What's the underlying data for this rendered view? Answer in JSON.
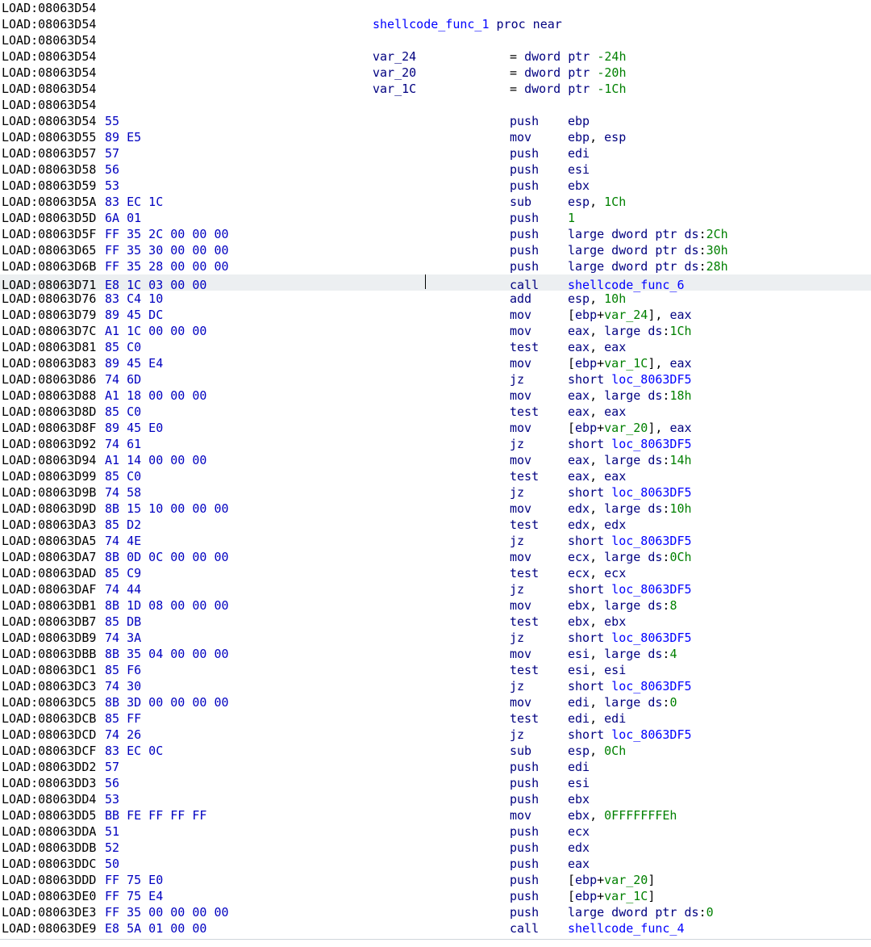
{
  "segment": "LOAD",
  "func_header": {
    "name": "shellcode_func_1",
    "kind": "proc near",
    "vars": [
      {
        "name": "var_24",
        "def": "= dword ptr -24h"
      },
      {
        "name": "var_20",
        "def": "= dword ptr -20h"
      },
      {
        "name": "var_1C",
        "def": "= dword ptr -1Ch"
      }
    ]
  },
  "rows": [
    {
      "addr": "08063D54",
      "kind": "blank"
    },
    {
      "addr": "08063D54",
      "kind": "func_name"
    },
    {
      "addr": "08063D54",
      "kind": "blank"
    },
    {
      "addr": "08063D54",
      "kind": "var",
      "var_index": 0
    },
    {
      "addr": "08063D54",
      "kind": "var",
      "var_index": 1
    },
    {
      "addr": "08063D54",
      "kind": "var",
      "var_index": 2
    },
    {
      "addr": "08063D54",
      "kind": "blank"
    },
    {
      "addr": "08063D54",
      "bytes": "55",
      "mn": "push",
      "ops": [
        {
          "t": "reg",
          "v": "ebp"
        }
      ]
    },
    {
      "addr": "08063D55",
      "bytes": "89 E5",
      "mn": "mov",
      "ops": [
        {
          "t": "reg",
          "v": "ebp"
        },
        {
          "t": "punc",
          "v": ", "
        },
        {
          "t": "reg",
          "v": "esp"
        }
      ]
    },
    {
      "addr": "08063D57",
      "bytes": "57",
      "mn": "push",
      "ops": [
        {
          "t": "reg",
          "v": "edi"
        }
      ]
    },
    {
      "addr": "08063D58",
      "bytes": "56",
      "mn": "push",
      "ops": [
        {
          "t": "reg",
          "v": "esi"
        }
      ]
    },
    {
      "addr": "08063D59",
      "bytes": "53",
      "mn": "push",
      "ops": [
        {
          "t": "reg",
          "v": "ebx"
        }
      ]
    },
    {
      "addr": "08063D5A",
      "bytes": "83 EC 1C",
      "mn": "sub",
      "ops": [
        {
          "t": "reg",
          "v": "esp"
        },
        {
          "t": "punc",
          "v": ", "
        },
        {
          "t": "num",
          "v": "1Ch"
        }
      ]
    },
    {
      "addr": "08063D5D",
      "bytes": "6A 01",
      "mn": "push",
      "ops": [
        {
          "t": "num",
          "v": "1"
        }
      ]
    },
    {
      "addr": "08063D5F",
      "bytes": "FF 35 2C 00 00 00",
      "mn": "push",
      "ops": [
        {
          "t": "kw",
          "v": "large dword ptr "
        },
        {
          "t": "reg",
          "v": "ds"
        },
        {
          "t": "punc",
          "v": ":"
        },
        {
          "t": "num",
          "v": "2Ch"
        }
      ]
    },
    {
      "addr": "08063D65",
      "bytes": "FF 35 30 00 00 00",
      "mn": "push",
      "ops": [
        {
          "t": "kw",
          "v": "large dword ptr "
        },
        {
          "t": "reg",
          "v": "ds"
        },
        {
          "t": "punc",
          "v": ":"
        },
        {
          "t": "num",
          "v": "30h"
        }
      ]
    },
    {
      "addr": "08063D6B",
      "bytes": "FF 35 28 00 00 00",
      "mn": "push",
      "ops": [
        {
          "t": "kw",
          "v": "large dword ptr "
        },
        {
          "t": "reg",
          "v": "ds"
        },
        {
          "t": "punc",
          "v": ":"
        },
        {
          "t": "num",
          "v": "28h"
        }
      ]
    },
    {
      "addr": "08063D71",
      "bytes": "E8 1C 03 00 00",
      "mn": "call",
      "ops": [
        {
          "t": "func",
          "v": "shellcode_func_6"
        }
      ],
      "highlight": true,
      "cursor": true
    },
    {
      "addr": "08063D76",
      "bytes": "83 C4 10",
      "mn": "add",
      "ops": [
        {
          "t": "reg",
          "v": "esp"
        },
        {
          "t": "punc",
          "v": ", "
        },
        {
          "t": "num",
          "v": "10h"
        }
      ]
    },
    {
      "addr": "08063D79",
      "bytes": "89 45 DC",
      "mn": "mov",
      "ops": [
        {
          "t": "punc",
          "v": "["
        },
        {
          "t": "reg",
          "v": "ebp"
        },
        {
          "t": "punc",
          "v": "+"
        },
        {
          "t": "var",
          "v": "var_24"
        },
        {
          "t": "punc",
          "v": "], "
        },
        {
          "t": "reg",
          "v": "eax"
        }
      ]
    },
    {
      "addr": "08063D7C",
      "bytes": "A1 1C 00 00 00",
      "mn": "mov",
      "ops": [
        {
          "t": "reg",
          "v": "eax"
        },
        {
          "t": "punc",
          "v": ", "
        },
        {
          "t": "kw",
          "v": "large "
        },
        {
          "t": "reg",
          "v": "ds"
        },
        {
          "t": "punc",
          "v": ":"
        },
        {
          "t": "num",
          "v": "1Ch"
        }
      ]
    },
    {
      "addr": "08063D81",
      "bytes": "85 C0",
      "mn": "test",
      "ops": [
        {
          "t": "reg",
          "v": "eax"
        },
        {
          "t": "punc",
          "v": ", "
        },
        {
          "t": "reg",
          "v": "eax"
        }
      ]
    },
    {
      "addr": "08063D83",
      "bytes": "89 45 E4",
      "mn": "mov",
      "ops": [
        {
          "t": "punc",
          "v": "["
        },
        {
          "t": "reg",
          "v": "ebp"
        },
        {
          "t": "punc",
          "v": "+"
        },
        {
          "t": "var",
          "v": "var_1C"
        },
        {
          "t": "punc",
          "v": "], "
        },
        {
          "t": "reg",
          "v": "eax"
        }
      ]
    },
    {
      "addr": "08063D86",
      "bytes": "74 6D",
      "mn": "jz",
      "ops": [
        {
          "t": "kw",
          "v": "short "
        },
        {
          "t": "func",
          "v": "loc_8063DF5"
        }
      ]
    },
    {
      "addr": "08063D88",
      "bytes": "A1 18 00 00 00",
      "mn": "mov",
      "ops": [
        {
          "t": "reg",
          "v": "eax"
        },
        {
          "t": "punc",
          "v": ", "
        },
        {
          "t": "kw",
          "v": "large "
        },
        {
          "t": "reg",
          "v": "ds"
        },
        {
          "t": "punc",
          "v": ":"
        },
        {
          "t": "num",
          "v": "18h"
        }
      ]
    },
    {
      "addr": "08063D8D",
      "bytes": "85 C0",
      "mn": "test",
      "ops": [
        {
          "t": "reg",
          "v": "eax"
        },
        {
          "t": "punc",
          "v": ", "
        },
        {
          "t": "reg",
          "v": "eax"
        }
      ]
    },
    {
      "addr": "08063D8F",
      "bytes": "89 45 E0",
      "mn": "mov",
      "ops": [
        {
          "t": "punc",
          "v": "["
        },
        {
          "t": "reg",
          "v": "ebp"
        },
        {
          "t": "punc",
          "v": "+"
        },
        {
          "t": "var",
          "v": "var_20"
        },
        {
          "t": "punc",
          "v": "], "
        },
        {
          "t": "reg",
          "v": "eax"
        }
      ]
    },
    {
      "addr": "08063D92",
      "bytes": "74 61",
      "mn": "jz",
      "ops": [
        {
          "t": "kw",
          "v": "short "
        },
        {
          "t": "func",
          "v": "loc_8063DF5"
        }
      ]
    },
    {
      "addr": "08063D94",
      "bytes": "A1 14 00 00 00",
      "mn": "mov",
      "ops": [
        {
          "t": "reg",
          "v": "eax"
        },
        {
          "t": "punc",
          "v": ", "
        },
        {
          "t": "kw",
          "v": "large "
        },
        {
          "t": "reg",
          "v": "ds"
        },
        {
          "t": "punc",
          "v": ":"
        },
        {
          "t": "num",
          "v": "14h"
        }
      ]
    },
    {
      "addr": "08063D99",
      "bytes": "85 C0",
      "mn": "test",
      "ops": [
        {
          "t": "reg",
          "v": "eax"
        },
        {
          "t": "punc",
          "v": ", "
        },
        {
          "t": "reg",
          "v": "eax"
        }
      ]
    },
    {
      "addr": "08063D9B",
      "bytes": "74 58",
      "mn": "jz",
      "ops": [
        {
          "t": "kw",
          "v": "short "
        },
        {
          "t": "func",
          "v": "loc_8063DF5"
        }
      ]
    },
    {
      "addr": "08063D9D",
      "bytes": "8B 15 10 00 00 00",
      "mn": "mov",
      "ops": [
        {
          "t": "reg",
          "v": "edx"
        },
        {
          "t": "punc",
          "v": ", "
        },
        {
          "t": "kw",
          "v": "large "
        },
        {
          "t": "reg",
          "v": "ds"
        },
        {
          "t": "punc",
          "v": ":"
        },
        {
          "t": "num",
          "v": "10h"
        }
      ]
    },
    {
      "addr": "08063DA3",
      "bytes": "85 D2",
      "mn": "test",
      "ops": [
        {
          "t": "reg",
          "v": "edx"
        },
        {
          "t": "punc",
          "v": ", "
        },
        {
          "t": "reg",
          "v": "edx"
        }
      ]
    },
    {
      "addr": "08063DA5",
      "bytes": "74 4E",
      "mn": "jz",
      "ops": [
        {
          "t": "kw",
          "v": "short "
        },
        {
          "t": "func",
          "v": "loc_8063DF5"
        }
      ]
    },
    {
      "addr": "08063DA7",
      "bytes": "8B 0D 0C 00 00 00",
      "mn": "mov",
      "ops": [
        {
          "t": "reg",
          "v": "ecx"
        },
        {
          "t": "punc",
          "v": ", "
        },
        {
          "t": "kw",
          "v": "large "
        },
        {
          "t": "reg",
          "v": "ds"
        },
        {
          "t": "punc",
          "v": ":"
        },
        {
          "t": "num",
          "v": "0Ch"
        }
      ]
    },
    {
      "addr": "08063DAD",
      "bytes": "85 C9",
      "mn": "test",
      "ops": [
        {
          "t": "reg",
          "v": "ecx"
        },
        {
          "t": "punc",
          "v": ", "
        },
        {
          "t": "reg",
          "v": "ecx"
        }
      ]
    },
    {
      "addr": "08063DAF",
      "bytes": "74 44",
      "mn": "jz",
      "ops": [
        {
          "t": "kw",
          "v": "short "
        },
        {
          "t": "func",
          "v": "loc_8063DF5"
        }
      ]
    },
    {
      "addr": "08063DB1",
      "bytes": "8B 1D 08 00 00 00",
      "mn": "mov",
      "ops": [
        {
          "t": "reg",
          "v": "ebx"
        },
        {
          "t": "punc",
          "v": ", "
        },
        {
          "t": "kw",
          "v": "large "
        },
        {
          "t": "reg",
          "v": "ds"
        },
        {
          "t": "punc",
          "v": ":"
        },
        {
          "t": "num",
          "v": "8"
        }
      ]
    },
    {
      "addr": "08063DB7",
      "bytes": "85 DB",
      "mn": "test",
      "ops": [
        {
          "t": "reg",
          "v": "ebx"
        },
        {
          "t": "punc",
          "v": ", "
        },
        {
          "t": "reg",
          "v": "ebx"
        }
      ]
    },
    {
      "addr": "08063DB9",
      "bytes": "74 3A",
      "mn": "jz",
      "ops": [
        {
          "t": "kw",
          "v": "short "
        },
        {
          "t": "func",
          "v": "loc_8063DF5"
        }
      ]
    },
    {
      "addr": "08063DBB",
      "bytes": "8B 35 04 00 00 00",
      "mn": "mov",
      "ops": [
        {
          "t": "reg",
          "v": "esi"
        },
        {
          "t": "punc",
          "v": ", "
        },
        {
          "t": "kw",
          "v": "large "
        },
        {
          "t": "reg",
          "v": "ds"
        },
        {
          "t": "punc",
          "v": ":"
        },
        {
          "t": "num",
          "v": "4"
        }
      ]
    },
    {
      "addr": "08063DC1",
      "bytes": "85 F6",
      "mn": "test",
      "ops": [
        {
          "t": "reg",
          "v": "esi"
        },
        {
          "t": "punc",
          "v": ", "
        },
        {
          "t": "reg",
          "v": "esi"
        }
      ]
    },
    {
      "addr": "08063DC3",
      "bytes": "74 30",
      "mn": "jz",
      "ops": [
        {
          "t": "kw",
          "v": "short "
        },
        {
          "t": "func",
          "v": "loc_8063DF5"
        }
      ]
    },
    {
      "addr": "08063DC5",
      "bytes": "8B 3D 00 00 00 00",
      "mn": "mov",
      "ops": [
        {
          "t": "reg",
          "v": "edi"
        },
        {
          "t": "punc",
          "v": ", "
        },
        {
          "t": "kw",
          "v": "large "
        },
        {
          "t": "reg",
          "v": "ds"
        },
        {
          "t": "punc",
          "v": ":"
        },
        {
          "t": "num",
          "v": "0"
        }
      ]
    },
    {
      "addr": "08063DCB",
      "bytes": "85 FF",
      "mn": "test",
      "ops": [
        {
          "t": "reg",
          "v": "edi"
        },
        {
          "t": "punc",
          "v": ", "
        },
        {
          "t": "reg",
          "v": "edi"
        }
      ]
    },
    {
      "addr": "08063DCD",
      "bytes": "74 26",
      "mn": "jz",
      "ops": [
        {
          "t": "kw",
          "v": "short "
        },
        {
          "t": "func",
          "v": "loc_8063DF5"
        }
      ]
    },
    {
      "addr": "08063DCF",
      "bytes": "83 EC 0C",
      "mn": "sub",
      "ops": [
        {
          "t": "reg",
          "v": "esp"
        },
        {
          "t": "punc",
          "v": ", "
        },
        {
          "t": "num",
          "v": "0Ch"
        }
      ]
    },
    {
      "addr": "08063DD2",
      "bytes": "57",
      "mn": "push",
      "ops": [
        {
          "t": "reg",
          "v": "edi"
        }
      ]
    },
    {
      "addr": "08063DD3",
      "bytes": "56",
      "mn": "push",
      "ops": [
        {
          "t": "reg",
          "v": "esi"
        }
      ]
    },
    {
      "addr": "08063DD4",
      "bytes": "53",
      "mn": "push",
      "ops": [
        {
          "t": "reg",
          "v": "ebx"
        }
      ]
    },
    {
      "addr": "08063DD5",
      "bytes": "BB FE FF FF FF",
      "mn": "mov",
      "ops": [
        {
          "t": "reg",
          "v": "ebx"
        },
        {
          "t": "punc",
          "v": ", "
        },
        {
          "t": "num",
          "v": "0FFFFFFFEh"
        }
      ]
    },
    {
      "addr": "08063DDA",
      "bytes": "51",
      "mn": "push",
      "ops": [
        {
          "t": "reg",
          "v": "ecx"
        }
      ]
    },
    {
      "addr": "08063DDB",
      "bytes": "52",
      "mn": "push",
      "ops": [
        {
          "t": "reg",
          "v": "edx"
        }
      ]
    },
    {
      "addr": "08063DDC",
      "bytes": "50",
      "mn": "push",
      "ops": [
        {
          "t": "reg",
          "v": "eax"
        }
      ]
    },
    {
      "addr": "08063DDD",
      "bytes": "FF 75 E0",
      "mn": "push",
      "ops": [
        {
          "t": "punc",
          "v": "["
        },
        {
          "t": "reg",
          "v": "ebp"
        },
        {
          "t": "punc",
          "v": "+"
        },
        {
          "t": "var",
          "v": "var_20"
        },
        {
          "t": "punc",
          "v": "]"
        }
      ]
    },
    {
      "addr": "08063DE0",
      "bytes": "FF 75 E4",
      "mn": "push",
      "ops": [
        {
          "t": "punc",
          "v": "["
        },
        {
          "t": "reg",
          "v": "ebp"
        },
        {
          "t": "punc",
          "v": "+"
        },
        {
          "t": "var",
          "v": "var_1C"
        },
        {
          "t": "punc",
          "v": "]"
        }
      ]
    },
    {
      "addr": "08063DE3",
      "bytes": "FF 35 00 00 00 00",
      "mn": "push",
      "ops": [
        {
          "t": "kw",
          "v": "large dword ptr "
        },
        {
          "t": "reg",
          "v": "ds"
        },
        {
          "t": "punc",
          "v": ":"
        },
        {
          "t": "num",
          "v": "0"
        }
      ]
    },
    {
      "addr": "08063DE9",
      "bytes": "E8 5A 01 00 00",
      "mn": "call",
      "ops": [
        {
          "t": "func",
          "v": "shellcode_func_4"
        }
      ]
    }
  ]
}
